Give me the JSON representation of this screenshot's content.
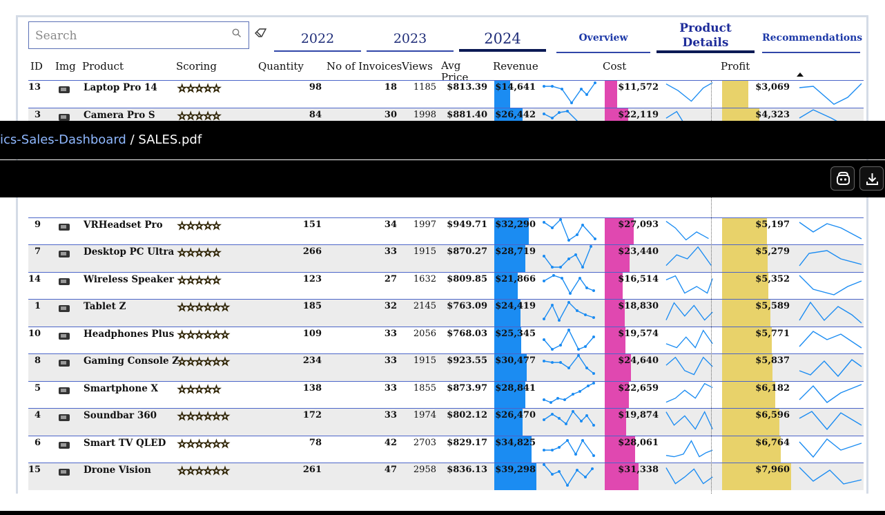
{
  "header": {
    "search_placeholder": "Search",
    "years": [
      "2022",
      "2023",
      "2024"
    ],
    "active_year": "2024",
    "nav_tabs": [
      "Overview",
      "Product Details",
      "Recommendations"
    ]
  },
  "columns": [
    "ID",
    "Img",
    "Product",
    "Scoring",
    "Quantity",
    "No of Invoices",
    "Views",
    "Avg Price",
    "Revenue",
    "Cost",
    "Profit"
  ],
  "rows": [
    {
      "id": "13",
      "img": "laptop-icon",
      "name": "Laptop Pro 14",
      "stars": "☆☆☆☆☆",
      "qty": "98",
      "inv": "18",
      "views": "1185",
      "avg": "$813.39",
      "rev": "$14,641",
      "cost": "$11,572",
      "profit": "$3,069"
    },
    {
      "id": "3",
      "img": "camera-icon",
      "name": "Camera Pro S",
      "stars": "☆☆☆☆☆",
      "qty": "84",
      "inv": "30",
      "views": "1998",
      "avg": "$881.40",
      "rev": "$26,442",
      "cost": "$22,119",
      "profit": "$4,323"
    },
    {
      "id": "9",
      "img": "vr-headset-icon",
      "name": "VRHeadset Pro",
      "stars": "☆☆☆☆☆",
      "qty": "151",
      "inv": "34",
      "views": "1997",
      "avg": "$949.71",
      "rev": "$32,290",
      "cost": "$27,093",
      "profit": "$5,197"
    },
    {
      "id": "7",
      "img": "desktop-icon",
      "name": "Desktop PC Ultra",
      "stars": "☆☆☆☆☆",
      "qty": "266",
      "inv": "33",
      "views": "1915",
      "avg": "$870.27",
      "rev": "$28,719",
      "cost": "$23,440",
      "profit": "$5,279"
    },
    {
      "id": "14",
      "img": "speaker-icon",
      "name": "Wireless Speaker",
      "stars": "☆☆☆☆☆",
      "qty": "123",
      "inv": "27",
      "views": "1632",
      "avg": "$809.85",
      "rev": "$21,866",
      "cost": "$16,514",
      "profit": "$5,352"
    },
    {
      "id": "1",
      "img": "tablet-icon",
      "name": "Tablet Z",
      "stars": "☆☆☆☆☆☆",
      "qty": "185",
      "inv": "32",
      "views": "2145",
      "avg": "$763.09",
      "rev": "$24,419",
      "cost": "$18,830",
      "profit": "$5,589"
    },
    {
      "id": "10",
      "img": "headphones-icon",
      "name": "Headphones Plus",
      "stars": "☆☆☆☆☆☆",
      "qty": "109",
      "inv": "33",
      "views": "2056",
      "avg": "$768.03",
      "rev": "$25,345",
      "cost": "$19,574",
      "profit": "$5,771"
    },
    {
      "id": "8",
      "img": "broken-image-icon",
      "name": "Gaming Console Z",
      "stars": "☆☆☆☆☆☆",
      "qty": "234",
      "inv": "33",
      "views": "1915",
      "avg": "$923.55",
      "rev": "$30,477",
      "cost": "$24,640",
      "profit": "$5,837"
    },
    {
      "id": "5",
      "img": "smartphone-icon",
      "name": "Smartphone X",
      "stars": "☆☆☆☆☆",
      "qty": "138",
      "inv": "33",
      "views": "1855",
      "avg": "$873.97",
      "rev": "$28,841",
      "cost": "$22,659",
      "profit": "$6,182"
    },
    {
      "id": "4",
      "img": "soundbar-icon",
      "name": "Soundbar 360",
      "stars": "☆☆☆☆☆☆",
      "qty": "172",
      "inv": "33",
      "views": "1974",
      "avg": "$802.12",
      "rev": "$26,470",
      "cost": "$19,874",
      "profit": "$6,596"
    },
    {
      "id": "6",
      "img": "tv-icon",
      "name": "Smart TV QLED",
      "stars": "☆☆☆☆☆☆",
      "qty": "78",
      "inv": "42",
      "views": "2703",
      "avg": "$829.17",
      "rev": "$34,825",
      "cost": "$28,061",
      "profit": "$6,764"
    },
    {
      "id": "15",
      "img": "drone-icon",
      "name": "Drone Vision",
      "stars": "☆☆☆☆☆☆",
      "qty": "261",
      "inv": "47",
      "views": "2958",
      "avg": "$836.13",
      "rev": "$39,298",
      "cost": "$31,338",
      "profit": "$7,960"
    }
  ],
  "viewer": {
    "breadcrumb_link": "ics-Sales-Dashboard",
    "breadcrumb_sep": " / ",
    "breadcrumb_file": "SALES.pdf"
  },
  "colors": {
    "revenue": "#1b8cf2",
    "cost": "#e048b0",
    "profit": "#e8d26a",
    "accent": "#1e2c9a"
  }
}
